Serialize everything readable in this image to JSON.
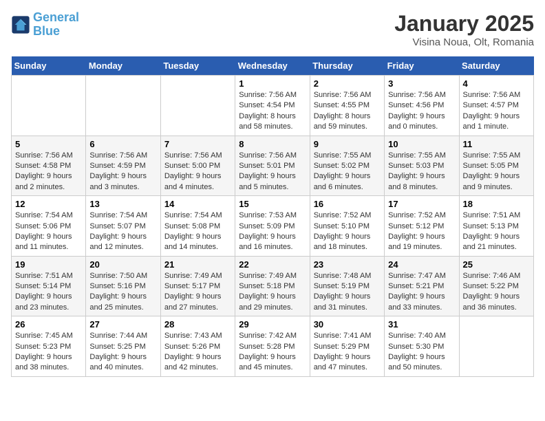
{
  "header": {
    "logo_line1": "General",
    "logo_line2": "Blue",
    "title": "January 2025",
    "subtitle": "Visina Noua, Olt, Romania"
  },
  "weekdays": [
    "Sunday",
    "Monday",
    "Tuesday",
    "Wednesday",
    "Thursday",
    "Friday",
    "Saturday"
  ],
  "weeks": [
    [
      {
        "day": "",
        "text": ""
      },
      {
        "day": "",
        "text": ""
      },
      {
        "day": "",
        "text": ""
      },
      {
        "day": "1",
        "text": "Sunrise: 7:56 AM\nSunset: 4:54 PM\nDaylight: 8 hours and 58 minutes."
      },
      {
        "day": "2",
        "text": "Sunrise: 7:56 AM\nSunset: 4:55 PM\nDaylight: 8 hours and 59 minutes."
      },
      {
        "day": "3",
        "text": "Sunrise: 7:56 AM\nSunset: 4:56 PM\nDaylight: 9 hours and 0 minutes."
      },
      {
        "day": "4",
        "text": "Sunrise: 7:56 AM\nSunset: 4:57 PM\nDaylight: 9 hours and 1 minute."
      }
    ],
    [
      {
        "day": "5",
        "text": "Sunrise: 7:56 AM\nSunset: 4:58 PM\nDaylight: 9 hours and 2 minutes."
      },
      {
        "day": "6",
        "text": "Sunrise: 7:56 AM\nSunset: 4:59 PM\nDaylight: 9 hours and 3 minutes."
      },
      {
        "day": "7",
        "text": "Sunrise: 7:56 AM\nSunset: 5:00 PM\nDaylight: 9 hours and 4 minutes."
      },
      {
        "day": "8",
        "text": "Sunrise: 7:56 AM\nSunset: 5:01 PM\nDaylight: 9 hours and 5 minutes."
      },
      {
        "day": "9",
        "text": "Sunrise: 7:55 AM\nSunset: 5:02 PM\nDaylight: 9 hours and 6 minutes."
      },
      {
        "day": "10",
        "text": "Sunrise: 7:55 AM\nSunset: 5:03 PM\nDaylight: 9 hours and 8 minutes."
      },
      {
        "day": "11",
        "text": "Sunrise: 7:55 AM\nSunset: 5:05 PM\nDaylight: 9 hours and 9 minutes."
      }
    ],
    [
      {
        "day": "12",
        "text": "Sunrise: 7:54 AM\nSunset: 5:06 PM\nDaylight: 9 hours and 11 minutes."
      },
      {
        "day": "13",
        "text": "Sunrise: 7:54 AM\nSunset: 5:07 PM\nDaylight: 9 hours and 12 minutes."
      },
      {
        "day": "14",
        "text": "Sunrise: 7:54 AM\nSunset: 5:08 PM\nDaylight: 9 hours and 14 minutes."
      },
      {
        "day": "15",
        "text": "Sunrise: 7:53 AM\nSunset: 5:09 PM\nDaylight: 9 hours and 16 minutes."
      },
      {
        "day": "16",
        "text": "Sunrise: 7:52 AM\nSunset: 5:10 PM\nDaylight: 9 hours and 18 minutes."
      },
      {
        "day": "17",
        "text": "Sunrise: 7:52 AM\nSunset: 5:12 PM\nDaylight: 9 hours and 19 minutes."
      },
      {
        "day": "18",
        "text": "Sunrise: 7:51 AM\nSunset: 5:13 PM\nDaylight: 9 hours and 21 minutes."
      }
    ],
    [
      {
        "day": "19",
        "text": "Sunrise: 7:51 AM\nSunset: 5:14 PM\nDaylight: 9 hours and 23 minutes."
      },
      {
        "day": "20",
        "text": "Sunrise: 7:50 AM\nSunset: 5:16 PM\nDaylight: 9 hours and 25 minutes."
      },
      {
        "day": "21",
        "text": "Sunrise: 7:49 AM\nSunset: 5:17 PM\nDaylight: 9 hours and 27 minutes."
      },
      {
        "day": "22",
        "text": "Sunrise: 7:49 AM\nSunset: 5:18 PM\nDaylight: 9 hours and 29 minutes."
      },
      {
        "day": "23",
        "text": "Sunrise: 7:48 AM\nSunset: 5:19 PM\nDaylight: 9 hours and 31 minutes."
      },
      {
        "day": "24",
        "text": "Sunrise: 7:47 AM\nSunset: 5:21 PM\nDaylight: 9 hours and 33 minutes."
      },
      {
        "day": "25",
        "text": "Sunrise: 7:46 AM\nSunset: 5:22 PM\nDaylight: 9 hours and 36 minutes."
      }
    ],
    [
      {
        "day": "26",
        "text": "Sunrise: 7:45 AM\nSunset: 5:23 PM\nDaylight: 9 hours and 38 minutes."
      },
      {
        "day": "27",
        "text": "Sunrise: 7:44 AM\nSunset: 5:25 PM\nDaylight: 9 hours and 40 minutes."
      },
      {
        "day": "28",
        "text": "Sunrise: 7:43 AM\nSunset: 5:26 PM\nDaylight: 9 hours and 42 minutes."
      },
      {
        "day": "29",
        "text": "Sunrise: 7:42 AM\nSunset: 5:28 PM\nDaylight: 9 hours and 45 minutes."
      },
      {
        "day": "30",
        "text": "Sunrise: 7:41 AM\nSunset: 5:29 PM\nDaylight: 9 hours and 47 minutes."
      },
      {
        "day": "31",
        "text": "Sunrise: 7:40 AM\nSunset: 5:30 PM\nDaylight: 9 hours and 50 minutes."
      },
      {
        "day": "",
        "text": ""
      }
    ]
  ]
}
